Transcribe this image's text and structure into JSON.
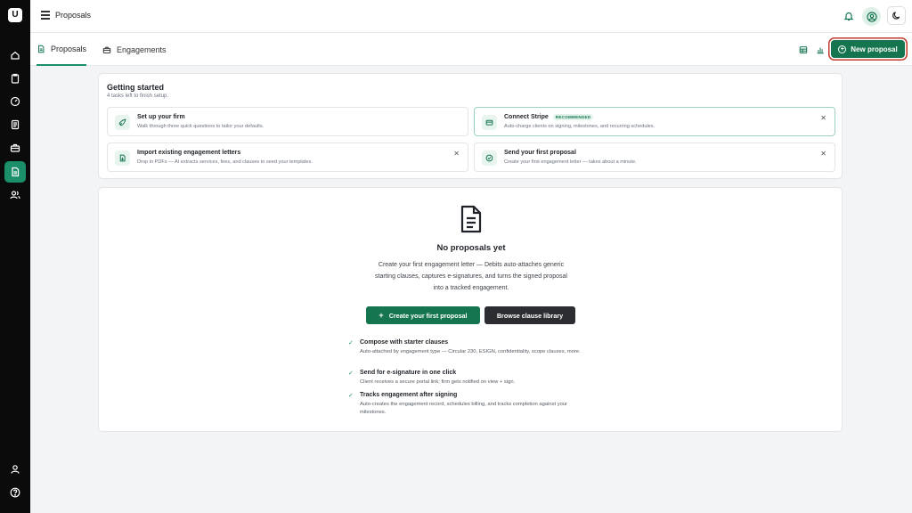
{
  "app": {
    "logo_text": "U",
    "page_title": "Proposals"
  },
  "rail": {
    "items": [
      "home-icon",
      "clipboard-icon",
      "gauge-icon",
      "ledger-icon",
      "briefcase-icon",
      "proposals-icon",
      "users-icon"
    ],
    "bottom": [
      "profile-icon",
      "help-icon"
    ],
    "active": "proposals-icon"
  },
  "tabs": [
    {
      "label": "Proposals",
      "icon": "document-icon",
      "active": true
    },
    {
      "label": "Engagements",
      "icon": "briefcase-icon",
      "active": false
    }
  ],
  "toolbar": {
    "new_label": "New proposal"
  },
  "getting_started": {
    "title": "Getting started",
    "subtitle": "4 tasks left to finish setup.",
    "tasks": [
      {
        "title": "Set up your firm",
        "desc": "Walk through three quick questions to tailor your defaults.",
        "icon": "rocket-icon",
        "badge": "",
        "dismissible": false
      },
      {
        "title": "Connect Stripe",
        "desc": "Auto-charge clients on signing, milestones, and recurring schedules.",
        "icon": "card-icon",
        "badge": "RECOMMENDED",
        "dismissible": true
      },
      {
        "title": "Import existing engagement letters",
        "desc": "Drop in PDFs — AI extracts services, fees, and clauses to seed your templates.",
        "icon": "file-import-icon",
        "badge": "",
        "dismissible": true
      },
      {
        "title": "Send your first proposal",
        "desc": "Create your first engagement letter — takes about a minute.",
        "icon": "check-circle-icon",
        "badge": "",
        "dismissible": true
      }
    ]
  },
  "empty_state": {
    "title": "No proposals yet",
    "description": "Create your first engagement letter — Debits auto-attaches generic starting clauses, captures e-signatures, and turns the signed proposal into a tracked engagement.",
    "primary_label": "Create your first proposal",
    "secondary_label": "Browse clause library",
    "features": [
      {
        "title": "Compose with starter clauses",
        "desc": "Auto-attached by engagement type — Circular 230, ESIGN, confidentiality, scope clauses, more."
      },
      {
        "title": "Send for e-signature in one click",
        "desc": "Client receives a secure portal link; firm gets notified on view + sign."
      },
      {
        "title": "Tracks engagement after signing",
        "desc": "Auto-creates the engagement record, schedules billing, and tracks completion against your milestones."
      }
    ]
  },
  "colors": {
    "accent": "#15754f",
    "rail_bg": "#0b0b0b",
    "focus_ring": "#c0392b"
  }
}
